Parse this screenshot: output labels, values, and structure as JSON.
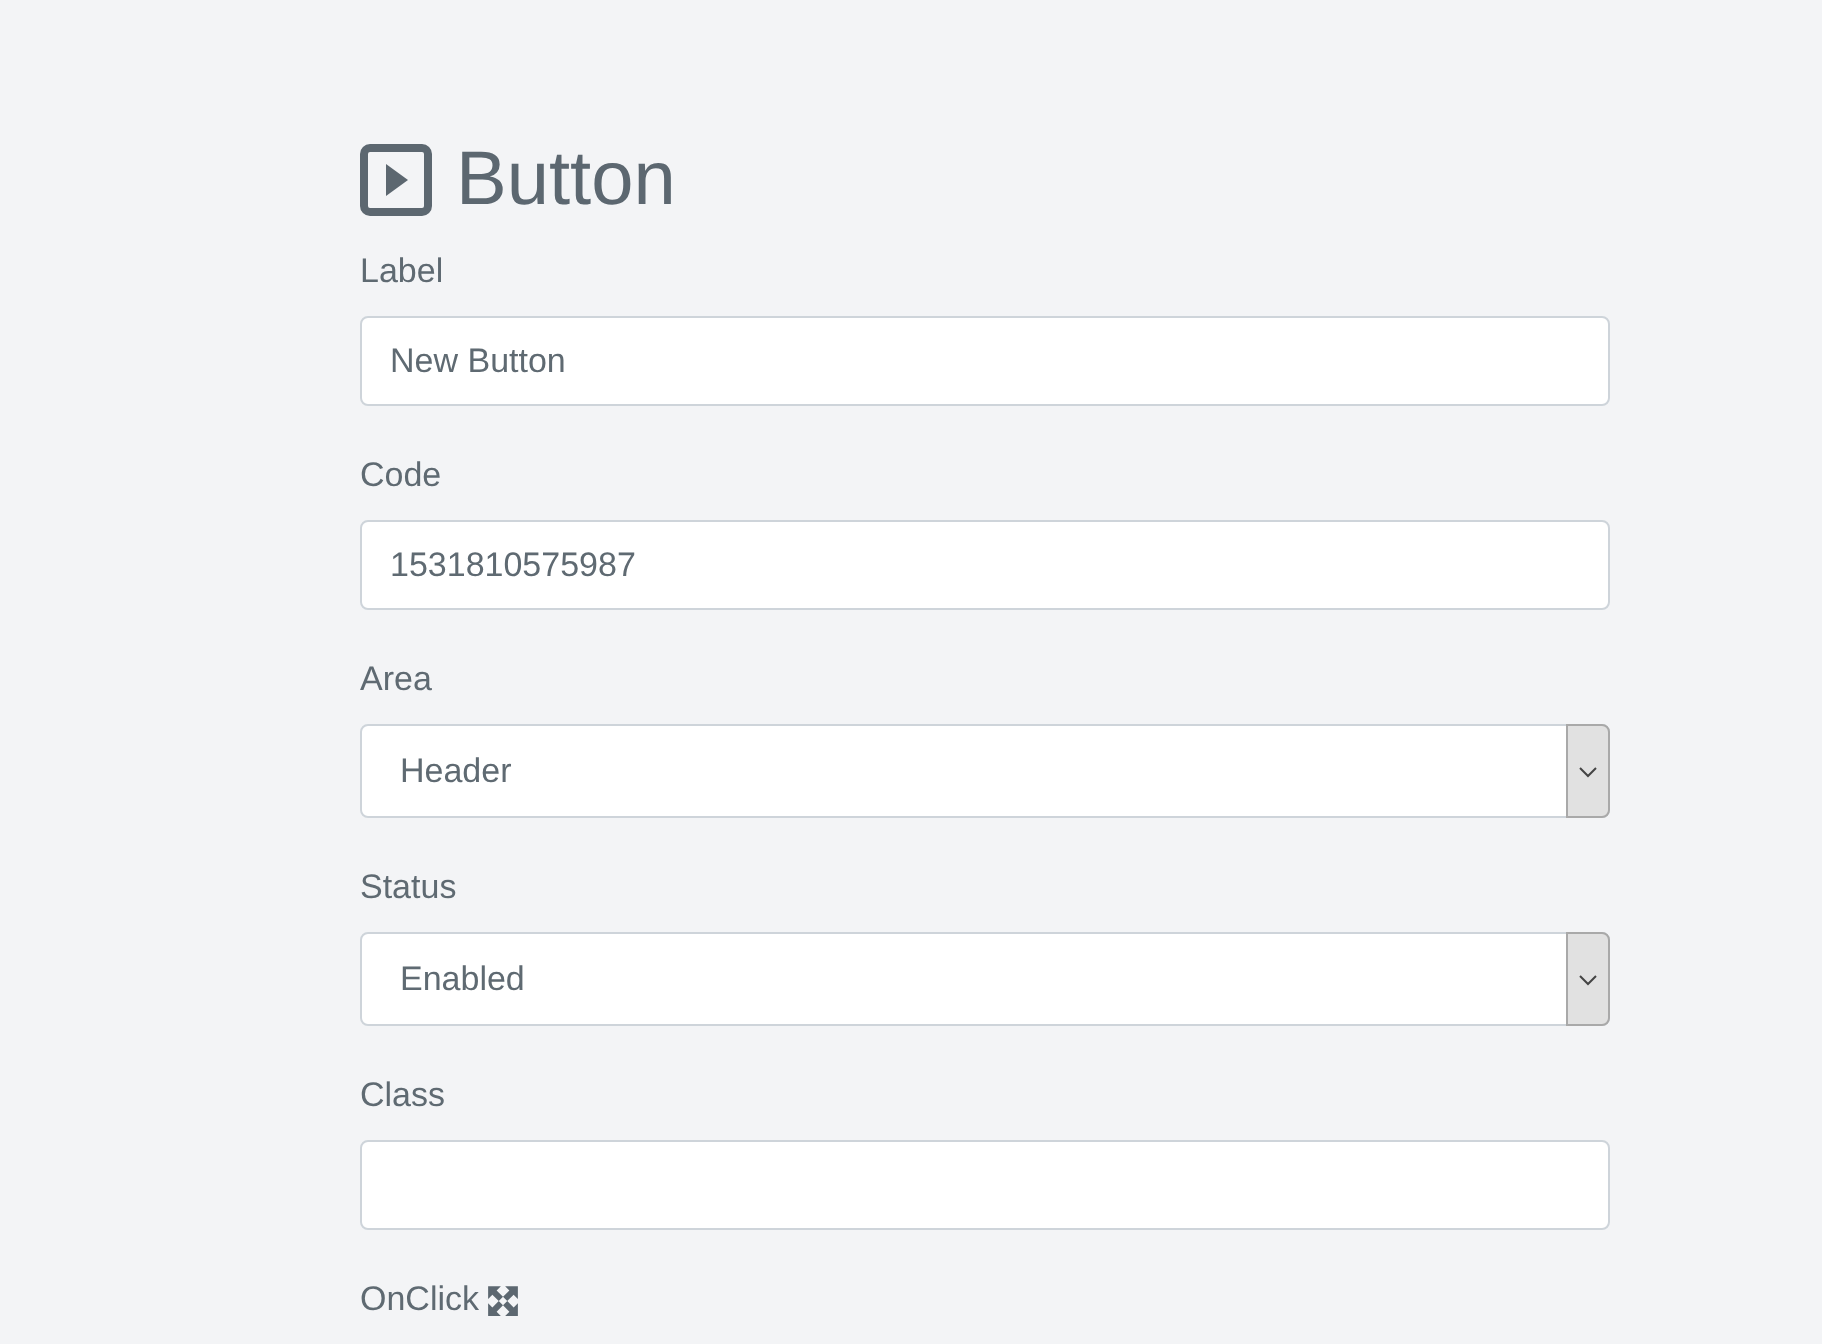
{
  "title": "Button",
  "fields": [
    {
      "kind": "text",
      "label": "Label",
      "value": "New Button"
    },
    {
      "kind": "text",
      "label": "Code",
      "value": "1531810575987"
    },
    {
      "kind": "select",
      "label": "Area",
      "value": "Header"
    },
    {
      "kind": "select",
      "label": "Status",
      "value": "Enabled"
    },
    {
      "kind": "text",
      "label": "Class"
    },
    {
      "kind": "expandable",
      "label": "OnClick"
    }
  ]
}
